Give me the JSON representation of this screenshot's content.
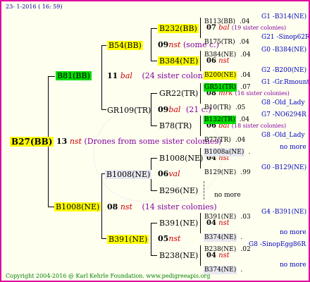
{
  "header": "23- 1-2016 ( 16: 59)",
  "footer": "Copyright 2004-2016 @ Karl Kehrle Foundation.   www.pedigreeapis.org",
  "root": {
    "code": "B27(BB)",
    "gen": "13",
    "nst": "nst",
    "note": "(Drones from some sister colonies)"
  },
  "sire_branch": {
    "code": "B81(BB)",
    "gen": "11",
    "nst": "bal",
    "note": "(24 sister colonies)"
  },
  "dam_branch": {
    "code": "B1008(NE)",
    "gen": "08",
    "nst": "nst",
    "note": "(14 sister colonies)"
  },
  "b54": {
    "code": "B54(BB)",
    "gen": "09",
    "nst": "nst",
    "note": "(some c.)"
  },
  "gr109": {
    "code": "GR109(TR)",
    "gen": "09",
    "nst": "bal",
    "note": "(21 c.)"
  },
  "b1008b": {
    "code": "B1008(NE)",
    "gen": "06",
    "nst": "val"
  },
  "b391": {
    "code": "B391(NE)",
    "gen": "05",
    "nst": "nst"
  },
  "b232": {
    "code": "B232(BB)",
    "gen": "07",
    "nst": "bal",
    "note": "(19 sister colonies)"
  },
  "b384": {
    "code": "B384(NE)",
    "gen": "06",
    "nst": "nst"
  },
  "gr22": {
    "code": "GR22(TR)",
    "gen": "08",
    "nst": "mrk",
    "note": "(16 sister colonies)"
  },
  "b78": {
    "code": "B78(TR)",
    "gen": "06",
    "nst": "bal",
    "note": "(18 sister colonies)"
  },
  "b1008c": {
    "code": "B1008(NE)",
    "gen": "04",
    "nst": "nst"
  },
  "b296": {
    "code": "B296(NE)"
  },
  "b391b": {
    "code": "B391(NE)",
    "gen": "04",
    "nst": "nst"
  },
  "b238": {
    "code": "B238(NE)",
    "gen": "04",
    "nst": "nst"
  },
  "leaves": [
    {
      "code": "B113(BB)",
      "val": ".04",
      "ref": "G1 -B314(NE)"
    },
    {
      "code": "B175(TR)",
      "val": ".04",
      "ref": "G21 -Sinop62R"
    },
    {
      "code": "B384(NE)",
      "val": ".04",
      "ref": "G0 -B384(NE)"
    },
    {
      "code": "B200(NE)",
      "val": ".04",
      "ref": "G2 -B200(NE)"
    },
    {
      "code": "GR51(TR)",
      "val": ".07",
      "ref": "G1 -Gr.Rmounta"
    },
    {
      "code": "B10(TR)",
      "val": ".05",
      "ref": "G8 -Old_Lady"
    },
    {
      "code": "B132(TR)",
      "val": ".04",
      "ref": "G7 -NO6294R"
    },
    {
      "code": "B77(TR)",
      "val": ".04",
      "ref": "G8 -Old_Lady"
    },
    {
      "code": "B1008a(NE)",
      "val": ".",
      "ref": "no more"
    },
    {
      "code": "B129(NE)",
      "val": ".99",
      "ref": "G0 -B129(NE)"
    },
    {
      "code": "",
      "val": "",
      "ref": "no more"
    },
    {
      "code": "B391(NE)",
      "val": ".03",
      "ref": "G4 -B391(NE)"
    },
    {
      "code": "B374(NE)",
      "val": ".",
      "ref": "no more"
    },
    {
      "code": "B238(NE)",
      "val": ".02",
      "ref": "G8 -SinopEgg86R"
    },
    {
      "code": "B374(NE)",
      "val": ".",
      "ref": "no more"
    }
  ]
}
